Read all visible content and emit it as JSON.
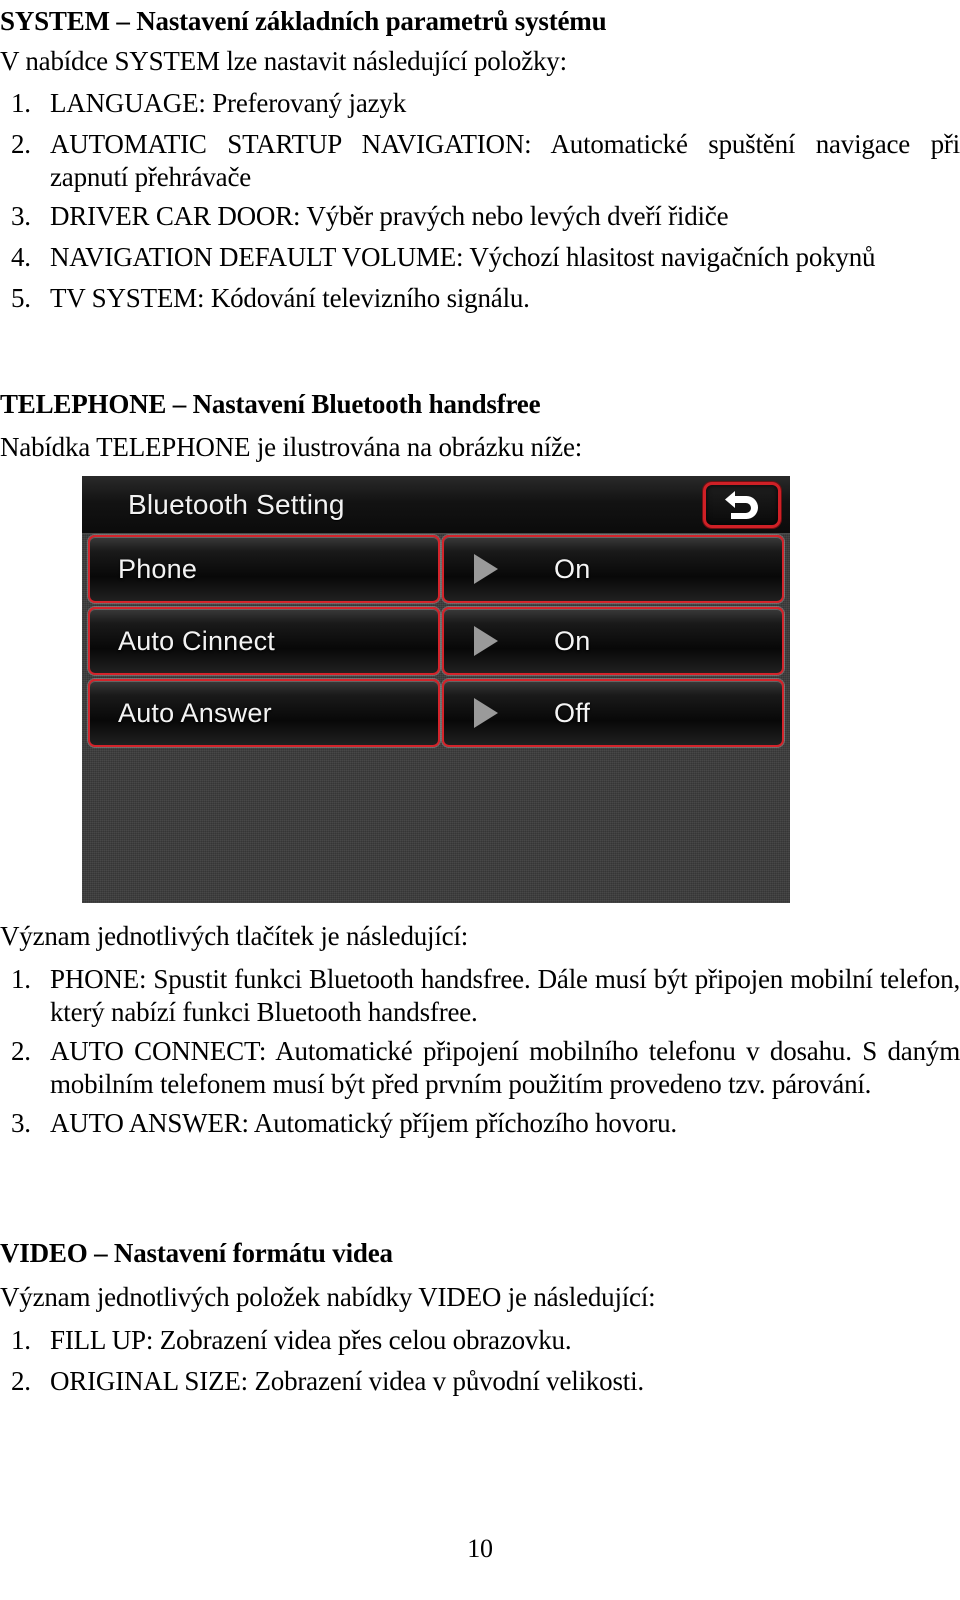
{
  "document": {
    "page_number": "10",
    "sections": [
      {
        "id": "system",
        "heading": "SYSTEM – Nastavení základních parametrů systému",
        "intro": "V nabídce SYSTEM lze nastavit následující položky:",
        "items": [
          {
            "num": "1.",
            "text": "LANGUAGE: Preferovaný jazyk"
          },
          {
            "num": "2.",
            "text": "AUTOMATIC STARTUP NAVIGATION: Automatické spuštění navigace při zapnutí přehrávače"
          },
          {
            "num": "3.",
            "text": "DRIVER CAR DOOR: Výběr pravých nebo levých dveří řidiče"
          },
          {
            "num": "4.",
            "text": "NAVIGATION DEFAULT VOLUME: Výchozí hlasitost navigačních pokynů"
          },
          {
            "num": "5.",
            "text": "TV SYSTEM: Kódování televizního signálu."
          }
        ]
      },
      {
        "id": "telephone",
        "heading": "TELEPHONE – Nastavení Bluetooth handsfree",
        "intro": "Nabídka TELEPHONE je ilustrována na obrázku níže:",
        "after_image_intro": "Význam jednotlivých tlačítek je následující:",
        "items": [
          {
            "num": "1.",
            "text": "PHONE: Spustit funkci Bluetooth handsfree. Dále musí být připojen mobilní telefon, který nabízí funkci Bluetooth handsfree."
          },
          {
            "num": "2.",
            "text": "AUTO CONNECT: Automatické připojení mobilního telefonu v dosahu. S daným mobilním telefonem musí být před prvním použitím provedeno tzv. párování."
          },
          {
            "num": "3.",
            "text": "AUTO ANSWER: Automatický příjem příchozího hovoru."
          }
        ]
      },
      {
        "id": "video",
        "heading": "VIDEO – Nastavení formátu videa",
        "intro": "Význam jednotlivých položek nabídky VIDEO je následující:",
        "items": [
          {
            "num": "1.",
            "text": "FILL UP: Zobrazení videa přes celou obrazovku."
          },
          {
            "num": "2.",
            "text": "ORIGINAL SIZE: Zobrazení videa v původní velikosti."
          }
        ]
      }
    ]
  },
  "device_screen": {
    "title": "Bluetooth Setting",
    "back_icon": "back-arrow-icon",
    "accent_color": "#d4242b",
    "background_color": "#3b3b3b",
    "text_color": "#f3f3f3",
    "rows": [
      {
        "label": "Phone",
        "value": "On",
        "arrow_icon": "play-triangle-icon"
      },
      {
        "label": "Auto Cinnect",
        "value": "On",
        "arrow_icon": "play-triangle-icon"
      },
      {
        "label": "Auto Answer",
        "value": "Off",
        "arrow_icon": "play-triangle-icon"
      }
    ]
  }
}
